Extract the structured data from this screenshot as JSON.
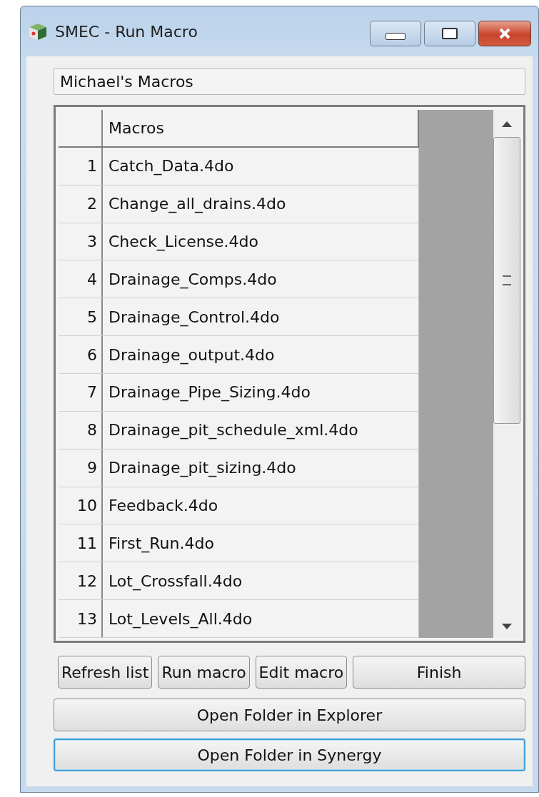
{
  "window": {
    "title": "SMEC - Run Macro"
  },
  "folder_field": {
    "value": "Michael's Macros"
  },
  "table": {
    "columns": [
      "Macros"
    ],
    "rows": [
      {
        "number": "1",
        "name": "Catch_Data.4do"
      },
      {
        "number": "2",
        "name": "Change_all_drains.4do"
      },
      {
        "number": "3",
        "name": "Check_License.4do"
      },
      {
        "number": "4",
        "name": "Drainage_Comps.4do"
      },
      {
        "number": "5",
        "name": "Drainage_Control.4do"
      },
      {
        "number": "6",
        "name": "Drainage_output.4do"
      },
      {
        "number": "7",
        "name": "Drainage_Pipe_Sizing.4do"
      },
      {
        "number": "8",
        "name": "Drainage_pit_schedule_xml.4do"
      },
      {
        "number": "9",
        "name": "Drainage_pit_sizing.4do"
      },
      {
        "number": "10",
        "name": "Feedback.4do"
      },
      {
        "number": "11",
        "name": "First_Run.4do"
      },
      {
        "number": "12",
        "name": "Lot_Crossfall.4do"
      },
      {
        "number": "13",
        "name": "Lot_Levels_All.4do"
      }
    ]
  },
  "action_buttons": [
    {
      "label": "Refresh list",
      "focused": false
    },
    {
      "label": "Run macro",
      "focused": false
    },
    {
      "label": "Edit macro",
      "focused": false
    },
    {
      "label": "Finish",
      "focused": false
    }
  ],
  "wide_buttons": [
    {
      "label": "Open Folder in Explorer",
      "focused": false
    },
    {
      "label": "Open Folder in Synergy",
      "focused": true
    }
  ]
}
